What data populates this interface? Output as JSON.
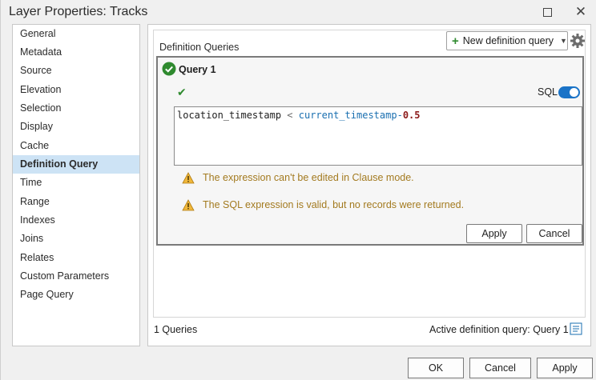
{
  "window": {
    "title": "Layer Properties: Tracks",
    "maximize_glyph": "",
    "close_glyph": "✕"
  },
  "sidebar": {
    "items": [
      {
        "label": "General"
      },
      {
        "label": "Metadata"
      },
      {
        "label": "Source"
      },
      {
        "label": "Elevation"
      },
      {
        "label": "Selection"
      },
      {
        "label": "Display"
      },
      {
        "label": "Cache"
      },
      {
        "label": "Definition Query",
        "active": true
      },
      {
        "label": "Time"
      },
      {
        "label": "Range"
      },
      {
        "label": "Indexes"
      },
      {
        "label": "Joins"
      },
      {
        "label": "Relates"
      },
      {
        "label": "Custom Parameters"
      },
      {
        "label": "Page Query"
      }
    ]
  },
  "main": {
    "section_label": "Definition Queries",
    "new_query_button": "New definition query",
    "query": {
      "title": "Query 1",
      "sql_label": "SQL",
      "sql_toggle_on": true,
      "expression": {
        "field": "location_timestamp",
        "operator": "<",
        "function": "current_timestamp",
        "minus": "-",
        "number": "0.5"
      },
      "warnings": [
        "The expression can't be edited in Clause mode.",
        "The SQL expression is valid, but no records were returned."
      ],
      "apply_label": "Apply",
      "cancel_label": "Cancel"
    },
    "footer": {
      "count": "1 Queries",
      "active": "Active definition query: Query 1"
    }
  },
  "dialog_buttons": {
    "ok": "OK",
    "cancel": "Cancel",
    "apply": "Apply"
  },
  "colors": {
    "accent": "#1a73c7",
    "success": "#2f8a2f",
    "warning": "#a37a1f",
    "selected": "#cde3f5"
  }
}
